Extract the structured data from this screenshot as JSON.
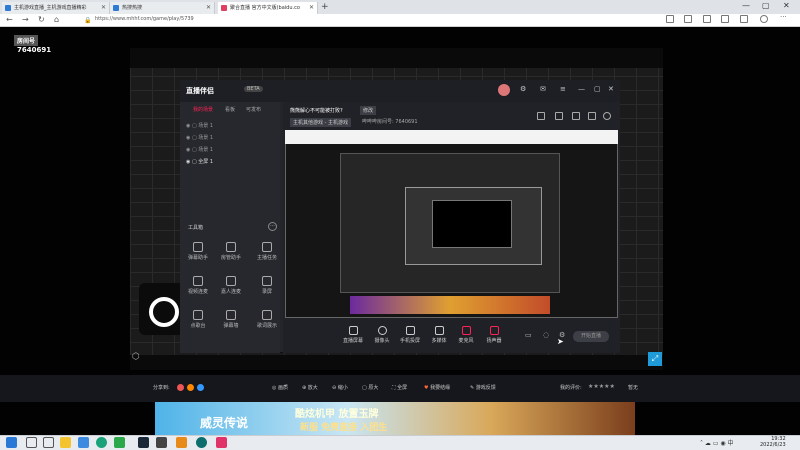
{
  "browser": {
    "tabs": [
      {
        "title": "主机游戏直播_主机游戏直播精彩",
        "color": "#2e7bd6",
        "active": false
      },
      {
        "title": "热搜热搜",
        "color": "#2e7bd6",
        "active": false
      },
      {
        "title": "神游神搜 「一门中 于何一 to to」",
        "color": "#20a0a0",
        "active": false
      },
      {
        "title": "聚合直播 官方中文版(baidu.co",
        "color": "#e04060",
        "active": true
      }
    ],
    "url": "https://www.mhhf.com/game/play/5739",
    "new_tab": "+",
    "win_controls": [
      "—",
      "▢",
      "✕"
    ]
  },
  "page": {
    "room_label": "房间号",
    "room_id": "7640691"
  },
  "app": {
    "logo": "直播伴侣",
    "version": "BETA",
    "sidebar_tabs": [
      "我的场景",
      "看板",
      "可发布"
    ],
    "scenes": [
      "场景 1",
      "场景 1",
      "场景 1",
      "全屏 1"
    ],
    "toolbox_title": "工具箱",
    "toolbox_more": "···",
    "tools": [
      "弹幕助手",
      "房管助手",
      "主播任务",
      "视频连麦",
      "嘉人连麦",
      "录屏",
      "点歌台",
      "弹幕墙",
      "歌词展示"
    ],
    "stream_title": "熊熊解心不可能被打败?",
    "modify_label": "修改",
    "category": "主机其他游戏 - 主机游戏",
    "room_info": "哔哔哔房间号: 7640691",
    "bottom_tools": [
      "直播屏幕",
      "摄像头",
      "手机投屏",
      "多媒体",
      "麦克风",
      "扬声器"
    ],
    "start_live": "开始直播"
  },
  "below": {
    "share": "分享到:",
    "items": [
      "画质",
      "放大",
      "缩小",
      "原大",
      "全屏",
      "我要结缘",
      "游戏反馈"
    ],
    "rate_label": "我的评价:",
    "stars": "★★★★★",
    "rate_value": "暂无"
  },
  "ad": {
    "title": "威灵传说",
    "line1": "酷炫机甲 放置玉牌",
    "line2": "新服 免费直接 入团生"
  },
  "taskbar": {
    "time": "19:32",
    "date": "2022/6/23"
  }
}
